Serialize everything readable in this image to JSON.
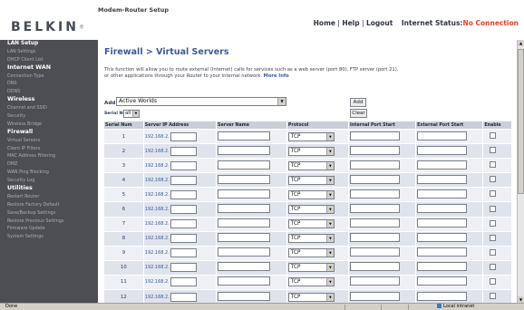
{
  "header": {
    "brand": "BELKIN",
    "brand_mark": "®",
    "product_title": "Modem-Router Setup",
    "nav_home": "Home",
    "nav_help": "Help",
    "nav_logout": "Logout",
    "sep": "|",
    "status_label": "Internet Status:",
    "status_value": "No Connection"
  },
  "sidebar": {
    "sections": [
      {
        "title": "LAN Setup",
        "items": [
          "LAN Settings",
          "DHCP Client List"
        ]
      },
      {
        "title": "Internet WAN",
        "items": [
          "Connection Type",
          "DNS",
          "DDNS"
        ]
      },
      {
        "title": "Wireless",
        "items": [
          "Channel and SSID",
          "Security",
          "Wireless Bridge"
        ]
      },
      {
        "title": "Firewall",
        "items": [
          "Virtual Servers",
          "Client IP Filters",
          "MAC Address Filtering",
          "DMZ",
          "WAN Ping Blocking",
          "Security Log"
        ]
      },
      {
        "title": "Utilities",
        "items": [
          "Restart Router",
          "Restore Factory Default",
          "Save/Backup Settings",
          "Restore Previous Settings",
          "Firmware Update",
          "System Settings"
        ]
      }
    ]
  },
  "main": {
    "title": "Firewall > Virtual Servers",
    "description": "This function will allow you to route external (Internet) calls for services such as a web server (port 80), FTP server (port 21), or other applications through your Router to your internal network.",
    "more_info": "More Info",
    "add_label": "Add",
    "app_select_value": "Active Worlds",
    "serial_label": "Serial Num",
    "serial_select_value": "all",
    "add_button": "Add",
    "clear_button": "Clear",
    "columns": [
      "Serial Num",
      "Server IP Address",
      "Server Name",
      "Protocol",
      "Internal Port Start",
      "External Port Start",
      "Enable"
    ],
    "ip_prefix": "192.168.2.",
    "rows": [
      {
        "num": "1",
        "protocol": "TCP"
      },
      {
        "num": "2",
        "protocol": "TCP"
      },
      {
        "num": "3",
        "protocol": "TCP"
      },
      {
        "num": "4",
        "protocol": "TCP"
      },
      {
        "num": "5",
        "protocol": "TCP"
      },
      {
        "num": "6",
        "protocol": "TCP"
      },
      {
        "num": "7",
        "protocol": "TCP"
      },
      {
        "num": "8",
        "protocol": "TCP"
      },
      {
        "num": "9",
        "protocol": "TCP"
      },
      {
        "num": "10",
        "protocol": "TCP"
      },
      {
        "num": "11",
        "protocol": "TCP"
      },
      {
        "num": "12",
        "protocol": "TCP"
      }
    ]
  },
  "statusbar": {
    "left": "Done",
    "zone": "Local intranet"
  },
  "icons": {
    "dropdown": "chevron-down-icon",
    "scroll_up": "scroll-up-icon",
    "scroll_down": "scroll-down-icon",
    "zone": "intranet-zone-icon"
  },
  "colors": {
    "sidebar_bg": "#4d4e53",
    "title_blue": "#3c5a9a",
    "status_red": "#e8402a",
    "table_header": "#c9ced7"
  }
}
